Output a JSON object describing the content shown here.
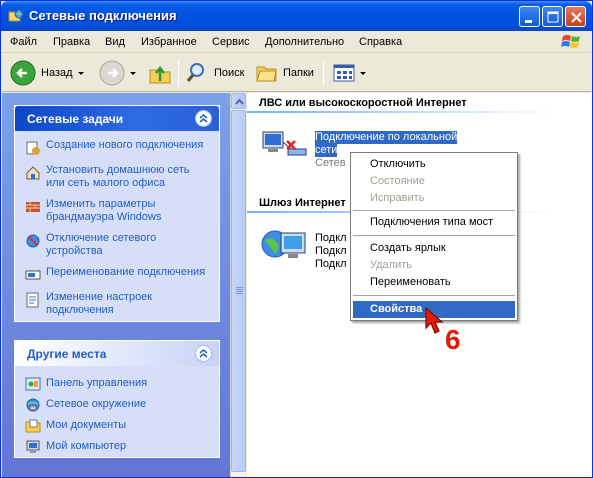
{
  "window": {
    "title": "Сетевые подключения"
  },
  "menu": [
    "Файл",
    "Правка",
    "Вид",
    "Избранное",
    "Сервис",
    "Дополнительно",
    "Справка"
  ],
  "toolbar": {
    "back": "Назад",
    "search": "Поиск",
    "folders": "Папки"
  },
  "tasks_panel": {
    "title": "Сетевые задачи",
    "items": [
      {
        "label": "Создание нового подключения",
        "icon": "new-connection-icon"
      },
      {
        "label": "Установить домашнюю сеть или сеть малого офиса",
        "icon": "home-network-icon"
      },
      {
        "label": "Изменить параметры брандмауэра Windows",
        "icon": "firewall-icon"
      },
      {
        "label": "Отключение сетевого устройства",
        "icon": "disable-device-icon"
      },
      {
        "label": "Переименование подключения",
        "icon": "rename-icon"
      },
      {
        "label": "Изменение настроек подключения",
        "icon": "settings-icon"
      }
    ]
  },
  "places_panel": {
    "title": "Другие места",
    "items": [
      {
        "label": "Панель управления",
        "icon": "control-panel-icon"
      },
      {
        "label": "Сетевое окружение",
        "icon": "network-places-icon"
      },
      {
        "label": "Мои документы",
        "icon": "my-documents-icon"
      },
      {
        "label": "Мой компьютер",
        "icon": "my-computer-icon"
      }
    ]
  },
  "content": {
    "lan_header": "ЛВС или высокоскоростной Интернет",
    "lan_conn_line1": "Подключение по локальной",
    "lan_conn_line2": "сети",
    "lan_conn_line3": "Сетев",
    "gateway_header": "Шлюз Интернет",
    "gw_line1": "Подкл",
    "gw_line2": "Подкл",
    "gw_line3": "Подкл"
  },
  "context_menu": {
    "disconnect": "Отключить",
    "status": "Состояние",
    "repair": "Исправить",
    "bridge": "Подключения типа мост",
    "shortcut": "Создать ярлык",
    "delete": "Удалить",
    "rename": "Переименовать",
    "properties": "Свойства"
  },
  "annotation": {
    "step": "6"
  },
  "colors": {
    "accent": "#316ac5",
    "link": "#215dc6",
    "annotation": "#e51b06"
  }
}
